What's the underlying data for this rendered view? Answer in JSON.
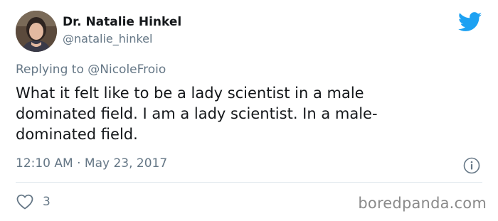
{
  "author": {
    "display_name": "Dr. Natalie Hinkel",
    "handle": "@natalie_hinkel"
  },
  "reply": {
    "prefix": "Replying to ",
    "mention": "@NicoleFroio"
  },
  "tweet": {
    "text": "What it felt like to be a lady scientist in a male\ndominated field. I am a lady scientist. In a male-\ndominated field.",
    "timestamp": "12:10 AM · May 23, 2017",
    "like_count": "3"
  },
  "watermark": "boredpanda.com",
  "icons": {
    "brand": "twitter-bird-icon",
    "info": "info-icon",
    "like": "heart-icon"
  },
  "colors": {
    "twitter_blue": "#1da1f2",
    "secondary_text": "#657786",
    "primary_text": "#14171a",
    "divider": "#e1e8ed"
  }
}
